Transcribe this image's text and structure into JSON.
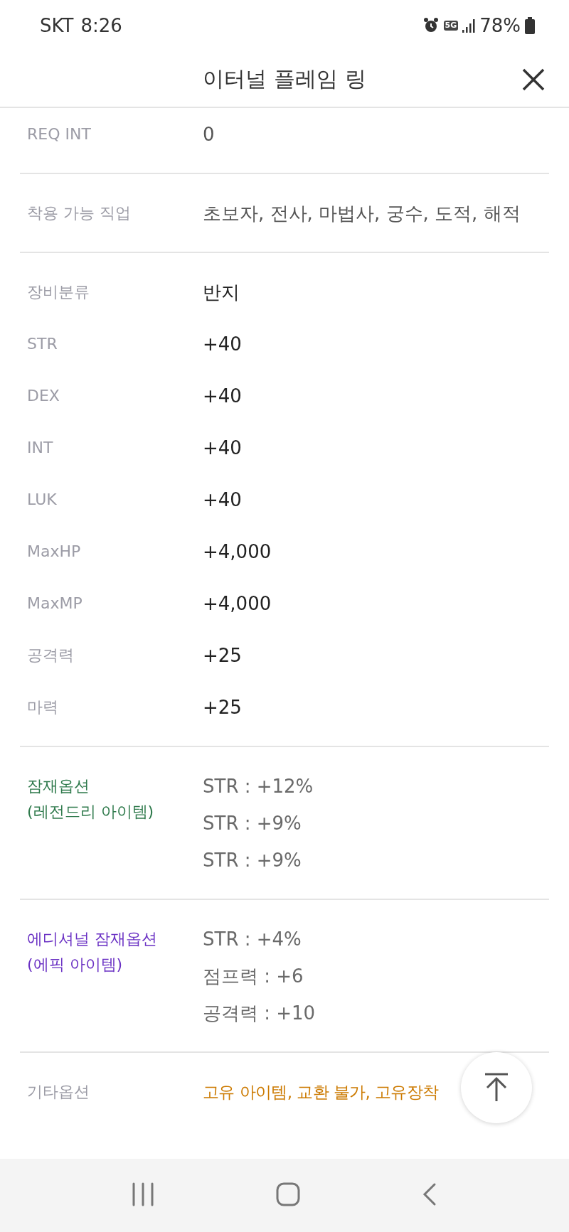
{
  "status_bar": {
    "carrier": "SKT",
    "time": "8:26",
    "network": "5G",
    "battery": "78%"
  },
  "header": {
    "title": "이터널 플레임 링"
  },
  "sections": [
    {
      "rows": [
        {
          "kind": "info",
          "label": "REQ INT",
          "values": [
            "0"
          ]
        }
      ]
    },
    {
      "rows": [
        {
          "kind": "info",
          "label": "착용 가능 직업",
          "values": [
            "초보자, 전사, 마법사, 궁수, 도적, 해적"
          ]
        }
      ]
    },
    {
      "rows": [
        {
          "kind": "stat",
          "label": "장비분류",
          "values": [
            "반지"
          ]
        },
        {
          "kind": "stat",
          "label": "STR",
          "values": [
            "+40"
          ]
        },
        {
          "kind": "stat",
          "label": "DEX",
          "values": [
            "+40"
          ]
        },
        {
          "kind": "stat",
          "label": "INT",
          "values": [
            "+40"
          ]
        },
        {
          "kind": "stat",
          "label": "LUK",
          "values": [
            "+40"
          ]
        },
        {
          "kind": "stat",
          "label": "MaxHP",
          "values": [
            "+4,000"
          ]
        },
        {
          "kind": "stat",
          "label": "MaxMP",
          "values": [
            "+4,000"
          ]
        },
        {
          "kind": "stat",
          "label": "공격력",
          "values": [
            "+25"
          ]
        },
        {
          "kind": "stat",
          "label": "마력",
          "values": [
            "+25"
          ]
        }
      ]
    },
    {
      "rows": [
        {
          "kind": "legendary",
          "label": "잠재옵션\n(레전드리 아이템)",
          "values": [
            "STR : +12%",
            "STR : +9%",
            "STR : +9%"
          ]
        }
      ]
    },
    {
      "rows": [
        {
          "kind": "epic",
          "label": "에디셔널 잠재옵션\n(에픽 아이템)",
          "values": [
            "STR : +4%",
            "점프력 : +6",
            "공격력 : +10"
          ]
        }
      ]
    },
    {
      "rows": [
        {
          "kind": "misc",
          "label": "기타옵션",
          "values": [
            "고유 아이템, 교환 불가, 고유장착"
          ]
        }
      ]
    }
  ]
}
